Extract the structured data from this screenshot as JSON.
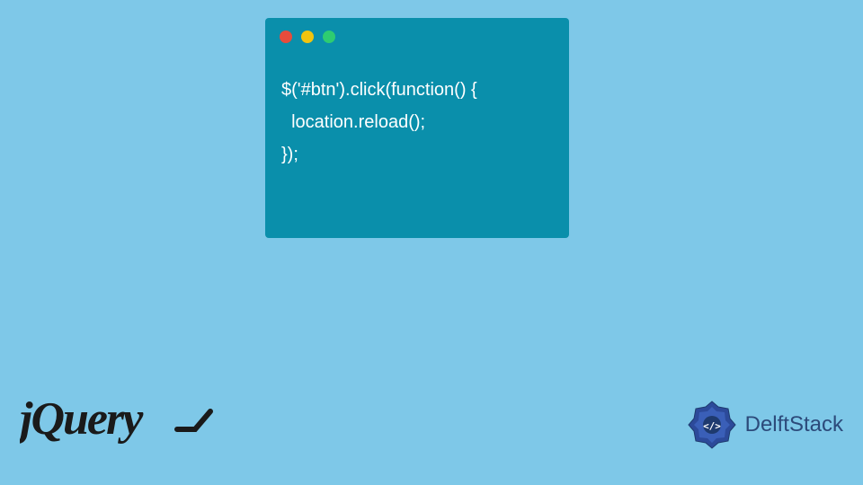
{
  "code_window": {
    "controls": {
      "red": "close",
      "yellow": "minimize",
      "green": "maximize"
    },
    "code": {
      "line1": "$('#btn').click(function() {",
      "line2": "  location.reload();",
      "line3": "});"
    }
  },
  "logos": {
    "jquery": "jQuery",
    "delftstack": "DelftStack"
  },
  "colors": {
    "background": "#7ec8e8",
    "window_bg": "#0a8fab",
    "dot_red": "#e74c3c",
    "dot_yellow": "#f1c40f",
    "dot_green": "#2ecc71"
  }
}
